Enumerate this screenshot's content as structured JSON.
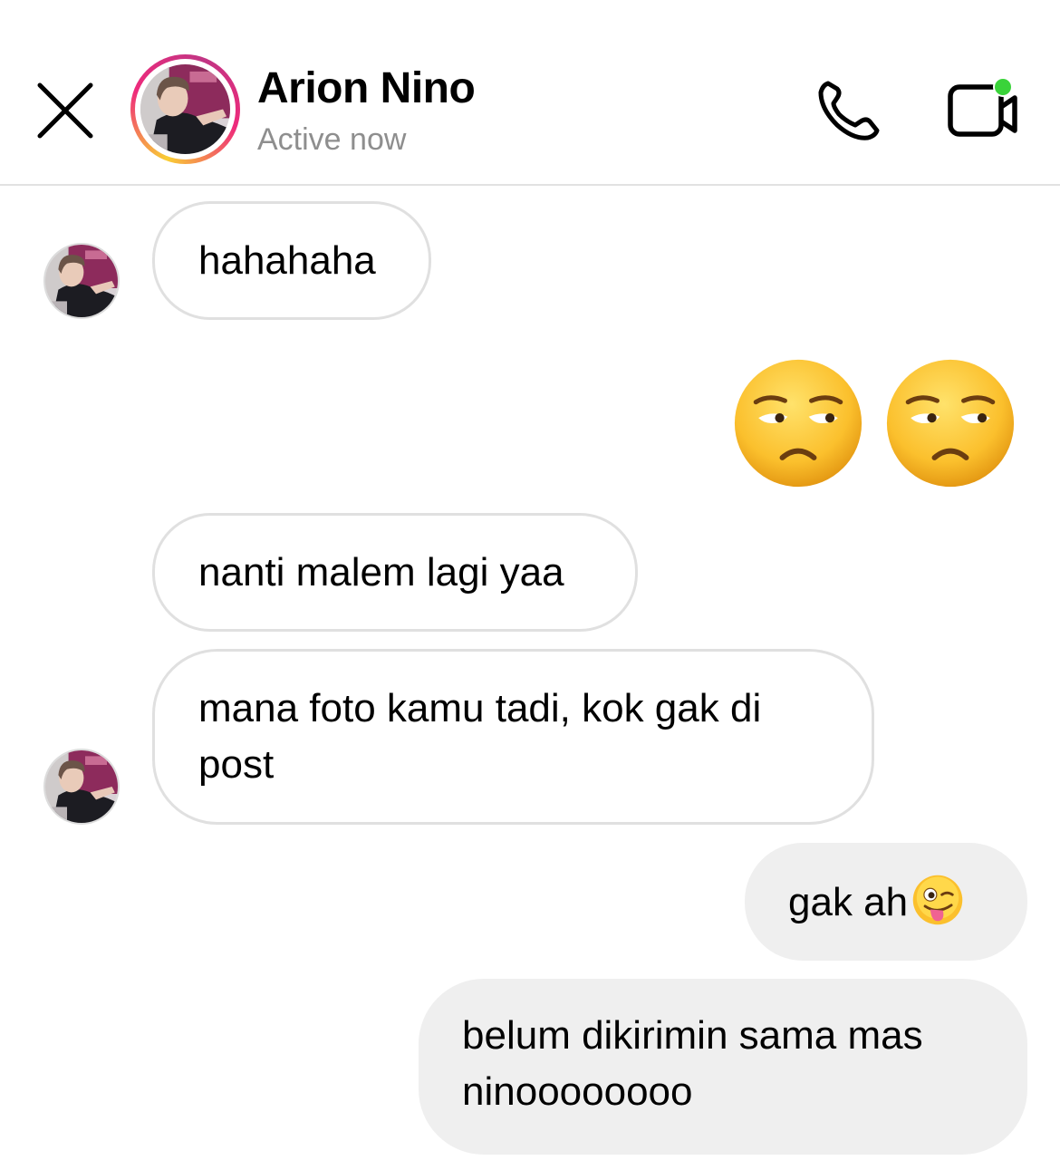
{
  "header": {
    "name": "Arion Nino",
    "status": "Active now",
    "close_icon": "close-icon",
    "call_icon": "phone-icon",
    "video_icon": "video-camera-icon",
    "online_indicator_color": "#3ad33a"
  },
  "messages": [
    {
      "direction": "in",
      "text": "hahahaha",
      "show_avatar": true
    },
    {
      "direction": "out",
      "type": "emoji",
      "emojis": [
        "unamused-face",
        "unamused-face"
      ]
    },
    {
      "direction": "in",
      "text": "nanti malem lagi yaa",
      "show_avatar": false
    },
    {
      "direction": "in",
      "lines": [
        "mana foto kamu tadi, kok gak di",
        "post"
      ],
      "show_avatar": true
    },
    {
      "direction": "out",
      "text": "gak ah",
      "emoji": "winking-face-with-tongue"
    },
    {
      "direction": "out",
      "lines": [
        "belum dikirimin sama mas",
        "ninoooooooo"
      ]
    }
  ],
  "colors": {
    "incoming_bubble_bg": "#ffffff",
    "incoming_bubble_border": "#e0e0e0",
    "outgoing_bubble_bg": "#efefef",
    "secondary_text": "#8e8e8e"
  }
}
